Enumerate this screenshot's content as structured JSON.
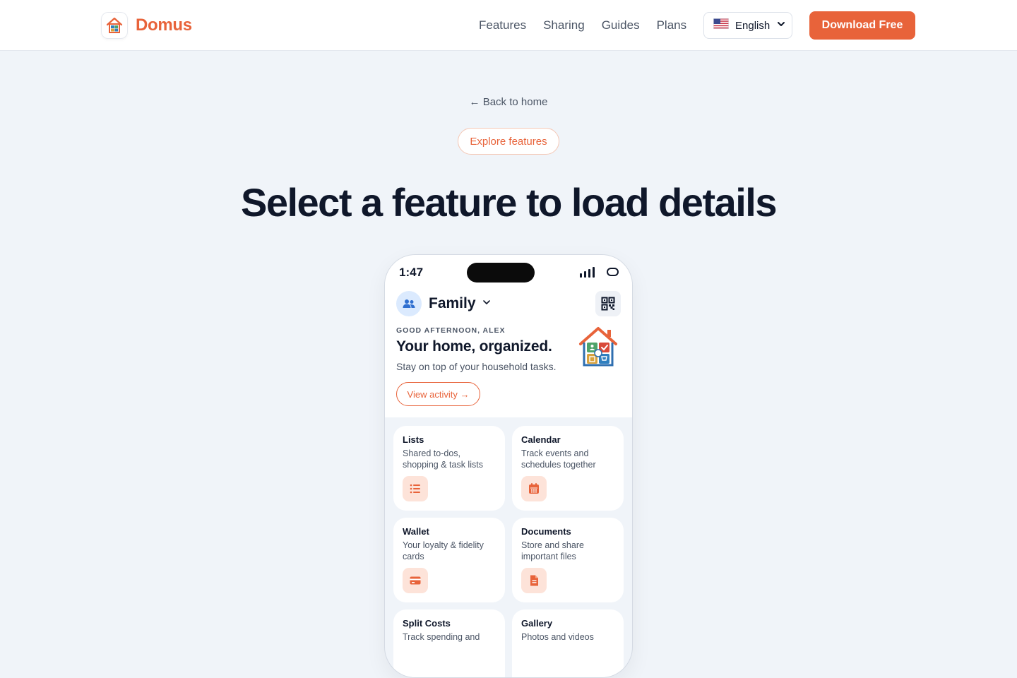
{
  "header": {
    "logo_text": "Domus",
    "nav": [
      "Features",
      "Sharing",
      "Guides",
      "Plans"
    ],
    "language": "English",
    "language_flag": "us-flag-icon",
    "download_label": "Download Free"
  },
  "hero": {
    "back_link": "← Back to home",
    "pill": "Explore features",
    "title": "Select a feature to load details"
  },
  "phone": {
    "time": "1:47",
    "family_name": "Family",
    "greeting": "GOOD AFTERNOON, ALEX",
    "title": "Your home, organized.",
    "subtitle": "Stay on top of your household tasks.",
    "activity_button": "View activity →",
    "cards": [
      {
        "title": "Lists",
        "desc": "Shared to-dos, shopping & task lists",
        "icon": "list-icon"
      },
      {
        "title": "Calendar",
        "desc": "Track events and schedules together",
        "icon": "calendar-icon"
      },
      {
        "title": "Wallet",
        "desc": "Your loyalty & fidelity cards",
        "icon": "card-icon"
      },
      {
        "title": "Documents",
        "desc": "Store and share important files",
        "icon": "document-icon"
      },
      {
        "title": "Split Costs",
        "desc": "Track spending and",
        "icon": "split-icon"
      },
      {
        "title": "Gallery",
        "desc": "Photos and videos",
        "icon": "gallery-icon"
      }
    ]
  },
  "colors": {
    "accent": "#e8633a",
    "accent_soft": "#fde3d9",
    "text_dark": "#0f172a",
    "text_muted": "#4b5565",
    "background": "#f0f4f9"
  }
}
